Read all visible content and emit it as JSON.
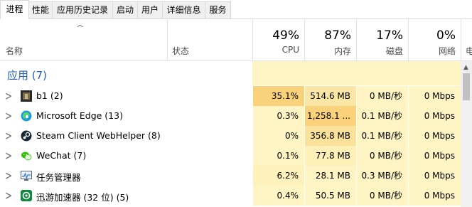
{
  "tabs": [
    "进程",
    "性能",
    "应用历史记录",
    "启动",
    "用户",
    "详细信息",
    "服务"
  ],
  "header": {
    "name_label": "名称",
    "status_label": "状态",
    "sort_arrow": "^",
    "cpu": {
      "pct": "49%",
      "label": "CPU"
    },
    "memory": {
      "pct": "87%",
      "label": "内存"
    },
    "disk": {
      "pct": "17%",
      "label": "磁盘"
    },
    "network": {
      "pct": "0%",
      "label": "网络"
    },
    "edge_label": "电"
  },
  "group": {
    "title": "应用 (7)"
  },
  "rows": [
    {
      "name": "b1 (2)",
      "icon": "b1-app-icon",
      "cpu": "35.1%",
      "mem": "514.6 MB",
      "disk": "0 MB/秒",
      "net": "0 Mbps",
      "cpu_color": "#f9d27b",
      "mem_color": "#fbe7a5"
    },
    {
      "name": "Microsoft Edge (13)",
      "icon": "edge-icon",
      "cpu": "0.3%",
      "mem": "1,258.1 ...",
      "disk": "0.1 MB/秒",
      "net": "0 Mbps",
      "cpu_color": "#fff4c4",
      "mem_color": "#f9d27b"
    },
    {
      "name": "Steam Client WebHelper (8)",
      "icon": "steam-icon",
      "cpu": "0%",
      "mem": "356.8 MB",
      "disk": "0.1 MB/秒",
      "net": "0 Mbps",
      "cpu_color": "#fff4c4",
      "mem_color": "#fbe29a"
    },
    {
      "name": "WeChat (7)",
      "icon": "wechat-icon",
      "cpu": "0.1%",
      "mem": "77.8 MB",
      "disk": "0 MB/秒",
      "net": "0 Mbps",
      "cpu_color": "#fff4c4",
      "mem_color": "#fff0b8"
    },
    {
      "name": "任务管理器",
      "icon": "task-manager-icon",
      "cpu": "6.2%",
      "mem": "28.1 MB",
      "disk": "0.3 MB/秒",
      "net": "0 Mbps",
      "cpu_color": "#fef1bb",
      "mem_color": "#fff4c4"
    },
    {
      "name": "迅游加速器 (32 位) (5)",
      "icon": "xunyou-icon",
      "cpu": "0.4%",
      "mem": "50.5 MB",
      "disk": "0 MB/秒",
      "net": "0 Mbps",
      "cpu_color": "#fff4c4",
      "mem_color": "#fff4c4"
    }
  ],
  "colors": {
    "cell_base": "#fff4c4",
    "group_title": "#1f5fbf"
  }
}
